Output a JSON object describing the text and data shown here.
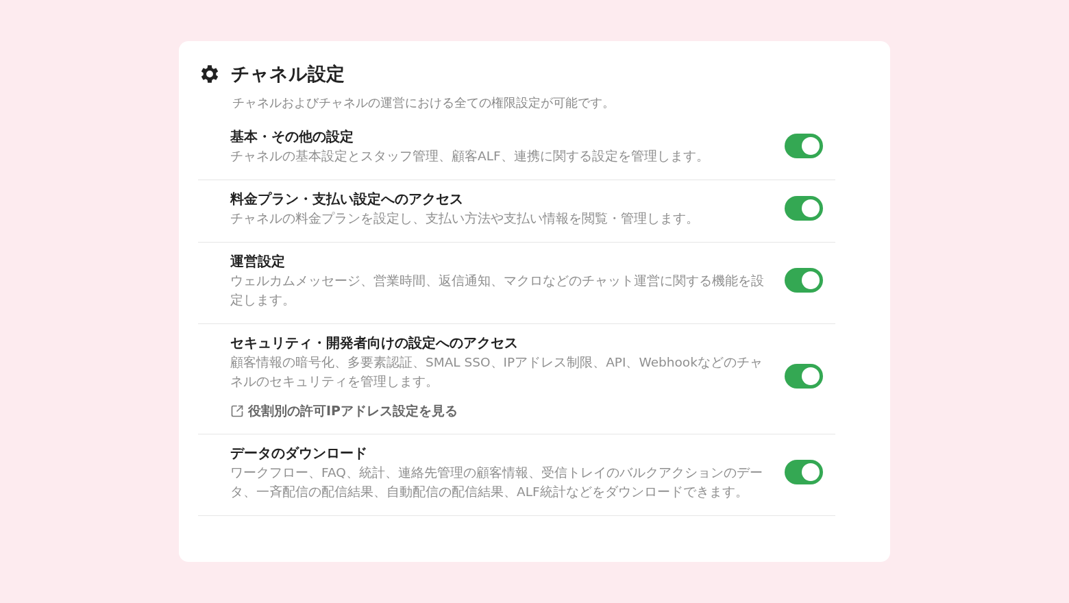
{
  "header": {
    "title": "チャネル設定",
    "description": "チャネルおよびチャネルの運営における全ての権限設定が可能です。"
  },
  "settings": [
    {
      "title": "基本・その他の設定",
      "description": "チャネルの基本設定とスタッフ管理、顧客ALF、連携に関する設定を管理します。",
      "on": true
    },
    {
      "title": "料金プラン・支払い設定へのアクセス",
      "description": "チャネルの料金プランを設定し、支払い方法や支払い情報を閲覧・管理します。",
      "on": true
    },
    {
      "title": "運営設定",
      "description": "ウェルカムメッセージ、営業時間、返信通知、マクロなどのチャット運営に関する機能を設定します。",
      "on": true
    },
    {
      "title": "セキュリティ・開発者向けの設定へのアクセス",
      "description": "顧客情報の暗号化、多要素認証、SMAL SSO、IPアドレス制限、API、Webhookなどのチャネルのセキュリティを管理します。",
      "on": true,
      "link": "役割別の許可IPアドレス設定を見る"
    },
    {
      "title": "データのダウンロード",
      "description": "ワークフロー、FAQ、統計、連絡先管理の顧客情報、受信トレイのバルクアクションのデータ、一斉配信の配信結果、自動配信の配信結果、ALF統計などをダウンロードできます。",
      "on": true
    }
  ]
}
